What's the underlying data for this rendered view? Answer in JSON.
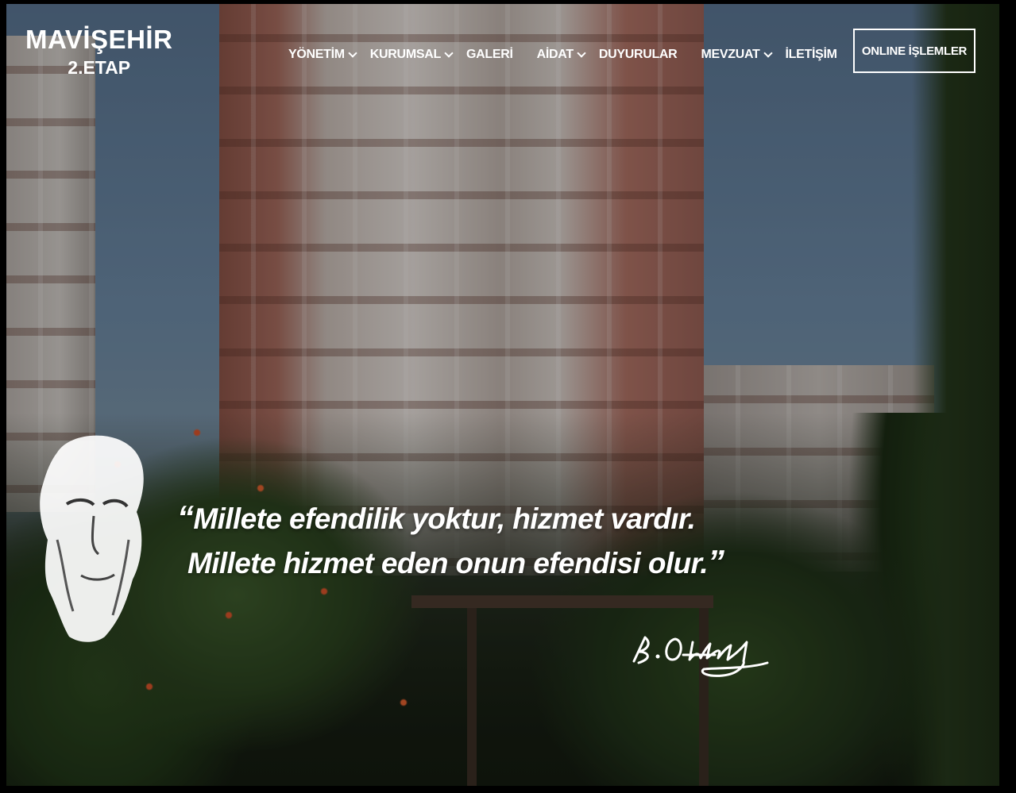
{
  "brand": {
    "line1": "MAVİŞEHİR",
    "line2": "2.ETAP"
  },
  "nav": {
    "items": [
      {
        "label": "YÖNETİM",
        "dropdown": true
      },
      {
        "label": "KURUMSAL",
        "dropdown": true
      },
      {
        "label": "GALERİ",
        "dropdown": false
      },
      {
        "label": "AİDAT",
        "dropdown": true
      },
      {
        "label": "DUYURULAR",
        "dropdown": false
      },
      {
        "label": "MEVZUAT",
        "dropdown": true
      },
      {
        "label": "İLETİŞİM",
        "dropdown": false
      }
    ],
    "cta_label": "ONLINE İŞLEMLER"
  },
  "hero": {
    "quote_open": "“",
    "quote_line1": "Millete efendilik yoktur, hizmet vardır.",
    "quote_line2": "Millete hizmet eden onun efendisi olur.",
    "quote_close": "”",
    "signature": "K. Atatürk"
  },
  "colors": {
    "text": "#ffffff",
    "overlay": "rgba(0,0,0,0.28)"
  }
}
